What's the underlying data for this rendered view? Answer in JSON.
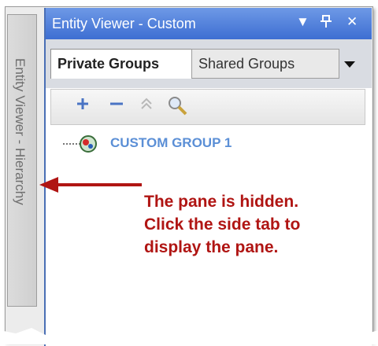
{
  "sidetab": {
    "label": "Entity Viewer - Hierarchy"
  },
  "pane": {
    "title": "Entity Viewer - Custom",
    "tabs": [
      {
        "label": "Private Groups",
        "active": true
      },
      {
        "label": "Shared Groups",
        "active": false
      }
    ],
    "toolbar": {
      "items": [
        "add-icon",
        "remove-icon",
        "move-up-icon",
        "search-icon"
      ]
    },
    "tree": {
      "items": [
        {
          "label": "CUSTOM GROUP 1"
        }
      ]
    }
  },
  "annotation": {
    "lines": [
      "The pane is hidden.",
      "Click the side tab to",
      "display the pane."
    ]
  },
  "colors": {
    "titlebar": "#3d6ed2",
    "annotation": "#b01513",
    "group_label": "#5b8fd6"
  }
}
